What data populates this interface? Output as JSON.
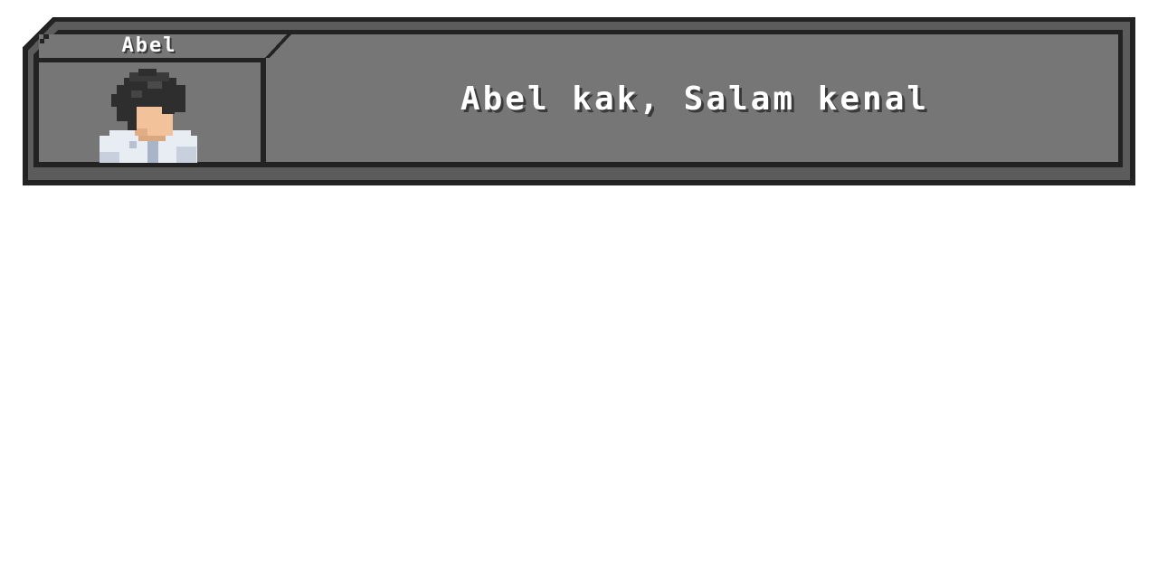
{
  "dialog": {
    "speaker": "Abel",
    "text": "Abel kak, Salam kenal",
    "portrait": "character-portrait-icon"
  },
  "colors": {
    "frame_outline": "#232323",
    "frame_fill": "#5c5c5c",
    "panel_fill": "#767676",
    "text": "#ffffff",
    "hair": "#2e2e2e",
    "skin": "#f2c39a",
    "coat": "#e8ecf3"
  }
}
